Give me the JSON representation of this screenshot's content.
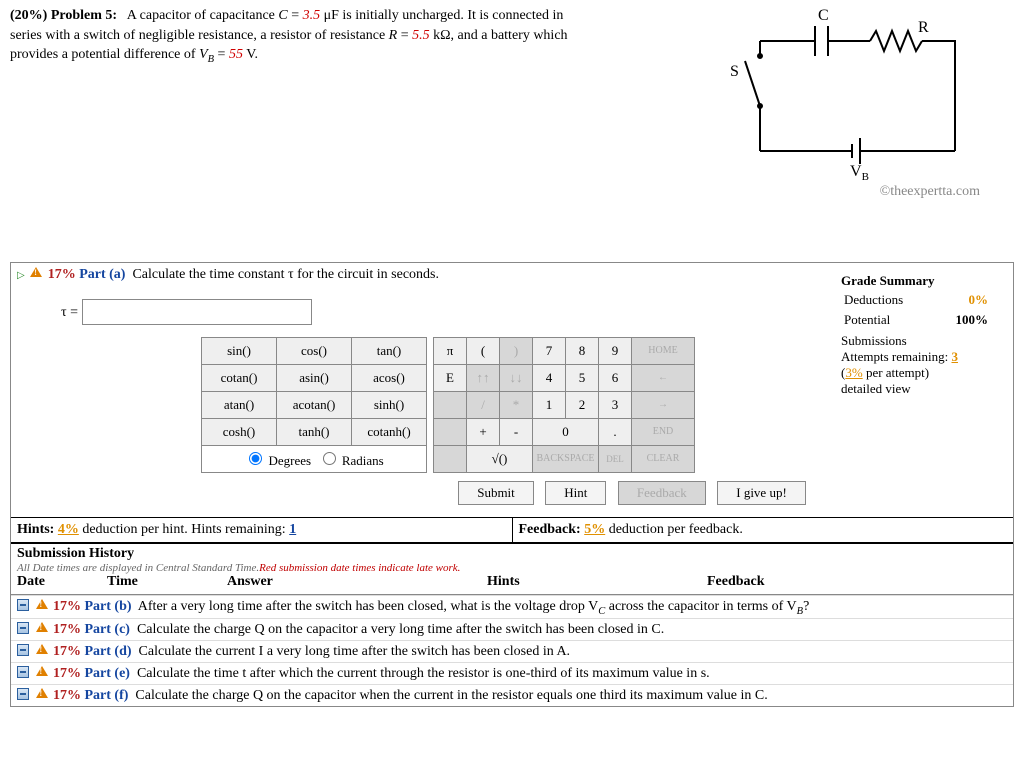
{
  "problem": {
    "weight_label": "(20%)",
    "title": "Problem 5:",
    "text1": "A capacitor of capacitance ",
    "C_sym": "C",
    "eq1": " = ",
    "C_val": "3.5",
    "C_unit": " μF is initially uncharged. It is connected in",
    "text2": "series with a switch of negligible resistance, a resistor of resistance ",
    "R_sym": "R",
    "eq2": " = ",
    "R_val": "5.5",
    "R_unit": " kΩ, and a battery which",
    "text3": "provides a potential difference of ",
    "V_sym": "V",
    "V_sub": "B",
    "eq3": " = ",
    "V_val": "55",
    "V_unit": " V."
  },
  "circuit_labels": {
    "C": "C",
    "R": "R",
    "S": "S",
    "VB": "V",
    "VB_sub": "B"
  },
  "watermark": "©theexpertta.com",
  "current_part": {
    "percent": "17%",
    "label": "Part (a)",
    "prompt": "Calculate the time constant τ for the circuit in seconds.",
    "lhs": "τ ="
  },
  "grade": {
    "title": "Grade Summary",
    "deduct_label": "Deductions",
    "deduct_val": "0%",
    "potential_label": "Potential",
    "potential_val": "100%"
  },
  "subs": {
    "title": "Submissions",
    "remain_label": "Attempts remaining: ",
    "remain_val": "3",
    "per": "(",
    "per_val": "3%",
    "per2": " per attempt)",
    "detailed": "detailed view"
  },
  "funcs": [
    [
      "sin()",
      "cos()",
      "tan()"
    ],
    [
      "cotan()",
      "asin()",
      "acos()"
    ],
    [
      "atan()",
      "acotan()",
      "sinh()"
    ],
    [
      "cosh()",
      "tanh()",
      "cotanh()"
    ]
  ],
  "mode": {
    "deg": "Degrees",
    "rad": "Radians"
  },
  "numpad": {
    "row1": [
      "π",
      "(",
      ")",
      "7",
      "8",
      "9",
      "HOME"
    ],
    "row2": [
      "E",
      "↑↑",
      "↓↓",
      "4",
      "5",
      "6",
      "←"
    ],
    "row3": [
      "",
      "/",
      "*",
      "1",
      "2",
      "3",
      "→"
    ],
    "row4": [
      "",
      "+",
      "-",
      "0",
      ".",
      "END"
    ],
    "row5": [
      "",
      "√()",
      "BACKSPACE",
      "DEL",
      "CLEAR"
    ]
  },
  "actions": {
    "submit": "Submit",
    "hint": "Hint",
    "feedback": "Feedback",
    "giveup": "I give up!"
  },
  "hints_bar": {
    "hints_label": "Hints:",
    "hints_pct": "4%",
    "hints_text": " deduction per hint. Hints remaining: ",
    "hints_remain": "1",
    "fb_label": "Feedback:",
    "fb_pct": "5%",
    "fb_text": " deduction per feedback."
  },
  "history": {
    "title": "Submission History",
    "note1": "All Date times are displayed in Central Standard Time.",
    "note2": "Red submission date times indicate late work.",
    "cols": [
      "Date",
      "Time",
      "Answer",
      "Hints",
      "Feedback"
    ]
  },
  "other_parts": [
    {
      "pct": "17%",
      "part": "Part (b)",
      "txt": "After a very long time after the switch has been closed, what is the voltage drop V",
      "sub": "C",
      "txt2": " across the capacitor in terms of V",
      "sub2": "B",
      "txt3": "?"
    },
    {
      "pct": "17%",
      "part": "Part (c)",
      "txt": "Calculate the charge Q on the capacitor a very long time after the switch has been closed in C."
    },
    {
      "pct": "17%",
      "part": "Part (d)",
      "txt": "Calculate the current I a very long time after the switch has been closed in A."
    },
    {
      "pct": "17%",
      "part": "Part (e)",
      "txt": "Calculate the time t after which the current through the resistor is one-third of its maximum value in s."
    },
    {
      "pct": "17%",
      "part": "Part (f)",
      "txt": "Calculate the charge Q on the capacitor when the current in the resistor equals one third its maximum value in C."
    }
  ]
}
